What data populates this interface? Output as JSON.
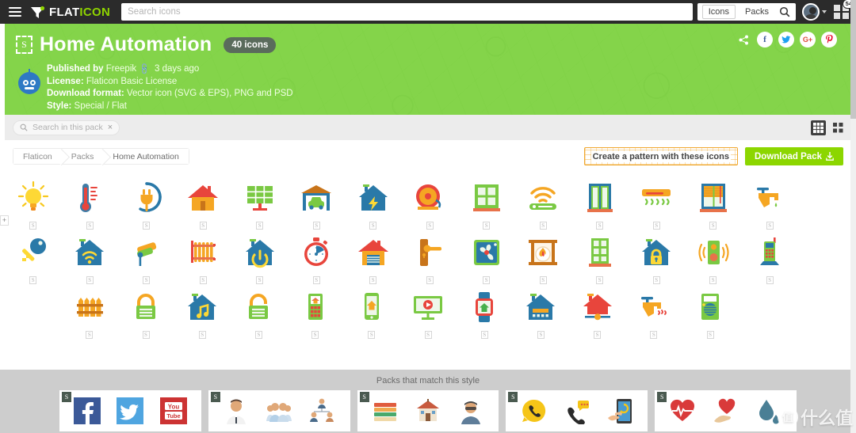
{
  "topnav": {
    "menu_icon": "hamburger-icon",
    "brand": {
      "white": "FLAT",
      "green": "ICON"
    },
    "search_placeholder": "Search icons",
    "search_value": "",
    "tab_icons": "Icons",
    "tab_packs": "Packs",
    "search_icon": "magnifier-icon",
    "apps_badge": "54"
  },
  "banner": {
    "pack_badge": "S",
    "title": "Home Automation",
    "count": "40 icons",
    "published_label": "Published by",
    "published_author": "Freepik",
    "published_time": "3 days ago",
    "license_label": "License:",
    "license_value": "Flaticon Basic License",
    "format_label": "Download format:",
    "format_value": "Vector icon (SVG & EPS), PNG and PSD",
    "style_label": "Style:",
    "style_value": "Special / Flat",
    "socials": [
      {
        "name": "share-icon",
        "glyph": "➦",
        "cls": "share"
      },
      {
        "name": "facebook-icon",
        "glyph": "f",
        "cls": "fb"
      },
      {
        "name": "twitter-icon",
        "glyph": "ᵗ",
        "cls": "tw"
      },
      {
        "name": "google-plus-icon",
        "glyph": "G+",
        "cls": "gp"
      },
      {
        "name": "pinterest-icon",
        "glyph": "ρ",
        "cls": "pi"
      }
    ]
  },
  "toolbar": {
    "pack_search_placeholder": "Search in this pack",
    "pack_search_value": "",
    "clear_label": "×",
    "view_list": "list-view-icon",
    "view_grid": "grid-view-icon"
  },
  "crumbrow": {
    "breadcrumbs": [
      "Flaticon",
      "Packs",
      "Home Automation"
    ],
    "pattern_button": "Create a pattern with these icons",
    "download_button": "Download Pack",
    "download_icon": "⬇"
  },
  "grid": {
    "item_badge": "S",
    "rows": [
      {
        "offset": 0,
        "items": [
          "lightbulb-icon",
          "thermometer-icon",
          "power-plug-icon",
          "house-icon",
          "solar-panel-icon",
          "garage-car-icon",
          "house-energy-icon",
          "alarm-bell-icon",
          "window-icon",
          "wifi-router-icon",
          "open-door-icon",
          "air-conditioner-icon",
          "window-blinds-icon",
          "water-faucet-icon"
        ]
      },
      {
        "offset": 0,
        "items": [
          "key-icon",
          "house-wifi-icon",
          "security-camera-icon",
          "radiator-icon",
          "house-power-icon",
          "stopwatch-icon",
          "house-garage-icon",
          "door-handle-icon",
          "ventilation-fan-icon",
          "fireplace-icon",
          "door-icon",
          "house-lock-icon",
          "speaker-icon",
          "cordless-phone-icon"
        ]
      },
      {
        "offset": 1,
        "items": [
          "fence-icon",
          "padlock-closed-icon",
          "house-music-icon",
          "padlock-open-icon",
          "keypad-remote-icon",
          "smartphone-home-icon",
          "smart-tv-icon",
          "smartwatch-home-icon",
          "smart-house-panel-icon",
          "house-slider-icon",
          "hot-water-faucet-icon",
          "intercom-radio-icon"
        ]
      }
    ]
  },
  "footer": {
    "title": "Packs that match this style",
    "packs": [
      {
        "name": "social-media-pack",
        "badge": "S",
        "thumbs": [
          "facebook-tile-icon",
          "twitter-tile-icon",
          "youtube-tile-icon"
        ]
      },
      {
        "name": "people-pack",
        "badge": "S",
        "thumbs": [
          "businessman-icon",
          "people-group-icon",
          "org-chart-icon"
        ]
      },
      {
        "name": "education-pack",
        "badge": "S",
        "thumbs": [
          "books-stack-icon",
          "school-icon",
          "student-icon"
        ]
      },
      {
        "name": "communication-pack",
        "badge": "S",
        "thumbs": [
          "phone-call-icon",
          "chat-phone-icon",
          "touch-phone-icon"
        ]
      },
      {
        "name": "health-pack",
        "badge": "S",
        "thumbs": [
          "heartbeat-icon",
          "heart-hand-icon",
          "water-drop-icon"
        ]
      }
    ]
  },
  "watermark": {
    "circle": "值",
    "text": "什么值"
  },
  "colors": {
    "brand_green": "#8fd400",
    "banner_green": "#84d44a",
    "download_green": "#8cd600",
    "nav_dark": "#2b2b2b",
    "pattern_orange": "#f0a830"
  }
}
